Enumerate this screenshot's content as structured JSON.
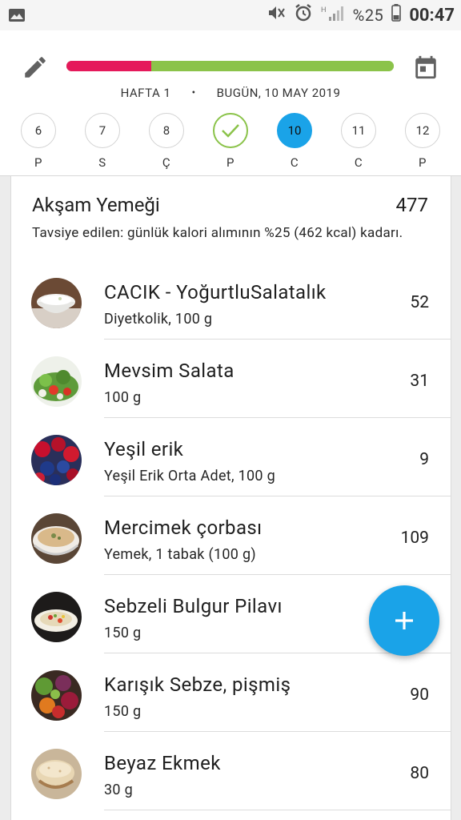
{
  "status_bar": {
    "battery_pct": "%25",
    "time": "00:47",
    "icons": [
      "image-icon",
      "mute-icon",
      "alarm-icon",
      "signal-icon",
      "battery-icon"
    ]
  },
  "header": {
    "week": "HAFTA 1",
    "separator": "•",
    "date": "BUGÜN, 10 MAY 2019",
    "progress_fraction": 0.26,
    "colors": {
      "consumed": "#e5195b",
      "remaining": "#8bc34a",
      "accent": "#1aa3e8"
    },
    "days": [
      {
        "num": "6",
        "label": "P",
        "state": "normal"
      },
      {
        "num": "7",
        "label": "S",
        "state": "normal"
      },
      {
        "num": "8",
        "label": "Ç",
        "state": "normal"
      },
      {
        "num": "",
        "label": "P",
        "state": "done"
      },
      {
        "num": "10",
        "label": "C",
        "state": "today"
      },
      {
        "num": "11",
        "label": "C",
        "state": "normal"
      },
      {
        "num": "12",
        "label": "P",
        "state": "normal"
      }
    ]
  },
  "meal": {
    "title": "Akşam Yemeği",
    "total": "477",
    "description": "Tavsiye edilen: günlük kalori alımının %25 (462 kcal) kadarı.",
    "foods": [
      {
        "name": "CACIK - YoğurtluSalatalık",
        "sub": "Diyetkolik, 100 g",
        "kcal": "52",
        "img": "yogurt"
      },
      {
        "name": "Mevsim Salata",
        "sub": "100 g",
        "kcal": "31",
        "img": "salad"
      },
      {
        "name": "Yeşil  erik",
        "sub": "Yeşil Erik Orta  Adet, 100 g",
        "kcal": "9",
        "img": "berries"
      },
      {
        "name": "Mercimek çorbası",
        "sub": "Yemek, 1 tabak (100 g)",
        "kcal": "109",
        "img": "soup"
      },
      {
        "name": "Sebzeli Bulgur Pilavı",
        "sub": "150 g",
        "kcal": "",
        "img": "pilaf"
      },
      {
        "name": "Karışık Sebze, pişmiş",
        "sub": "150 g",
        "kcal": "90",
        "img": "veggies"
      },
      {
        "name": "Beyaz Ekmek",
        "sub": "30 g",
        "kcal": "80",
        "img": "bread"
      }
    ]
  },
  "fab": {
    "label": "+"
  }
}
